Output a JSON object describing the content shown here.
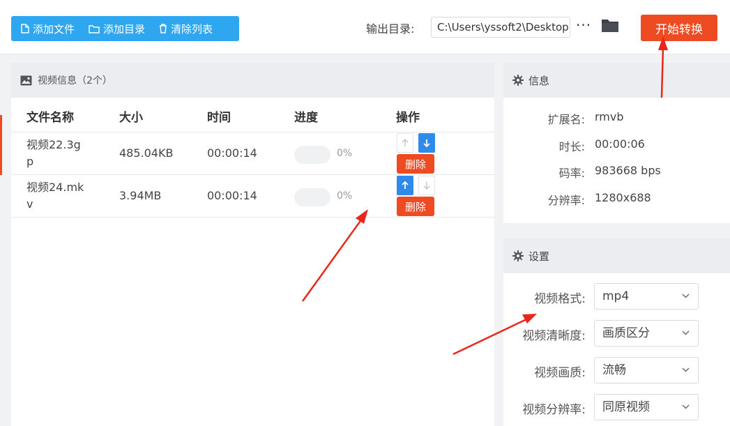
{
  "toolbar": {
    "add_file": "添加文件",
    "add_dir": "添加目录",
    "clear_list": "清除列表",
    "output_label": "输出目录:",
    "output_path": "C:\\Users\\yssoft2\\Desktop",
    "more": "···",
    "start": "开始转换"
  },
  "video_panel": {
    "title": "视频信息（2个）",
    "columns": [
      "文件名称",
      "大小",
      "时间",
      "进度",
      "操作"
    ],
    "rows": [
      {
        "name_line1": "视频22.3g",
        "name_line2": "p",
        "size": "485.04KB",
        "time": "00:00:14",
        "progress": 0,
        "progress_text": "0%",
        "up_enabled": false,
        "down_enabled": true,
        "delete": "删除"
      },
      {
        "name_line1": "视频24.mk",
        "name_line2": "v",
        "size": "3.94MB",
        "time": "00:00:14",
        "progress": 0,
        "progress_text": "0%",
        "up_enabled": true,
        "down_enabled": false,
        "delete": "删除"
      }
    ]
  },
  "info_panel": {
    "title": "信息",
    "items": [
      {
        "label": "扩展名:",
        "value": "rmvb"
      },
      {
        "label": "时长:",
        "value": "00:00:06"
      },
      {
        "label": "码率:",
        "value": "983668 bps"
      },
      {
        "label": "分辨率:",
        "value": "1280x688"
      }
    ]
  },
  "settings_panel": {
    "title": "设置",
    "items": [
      {
        "label": "视频格式:",
        "value": "mp4"
      },
      {
        "label": "视频清晰度:",
        "value": "画质区分"
      },
      {
        "label": "视频画质:",
        "value": "流畅"
      },
      {
        "label": "视频分辨率:",
        "value": "同原视频"
      }
    ]
  },
  "colors": {
    "accent_blue": "#2fa6f0",
    "accent_red": "#ee4b23",
    "arrow_blue": "#2f8bea",
    "annotation_red": "#e8261a"
  }
}
